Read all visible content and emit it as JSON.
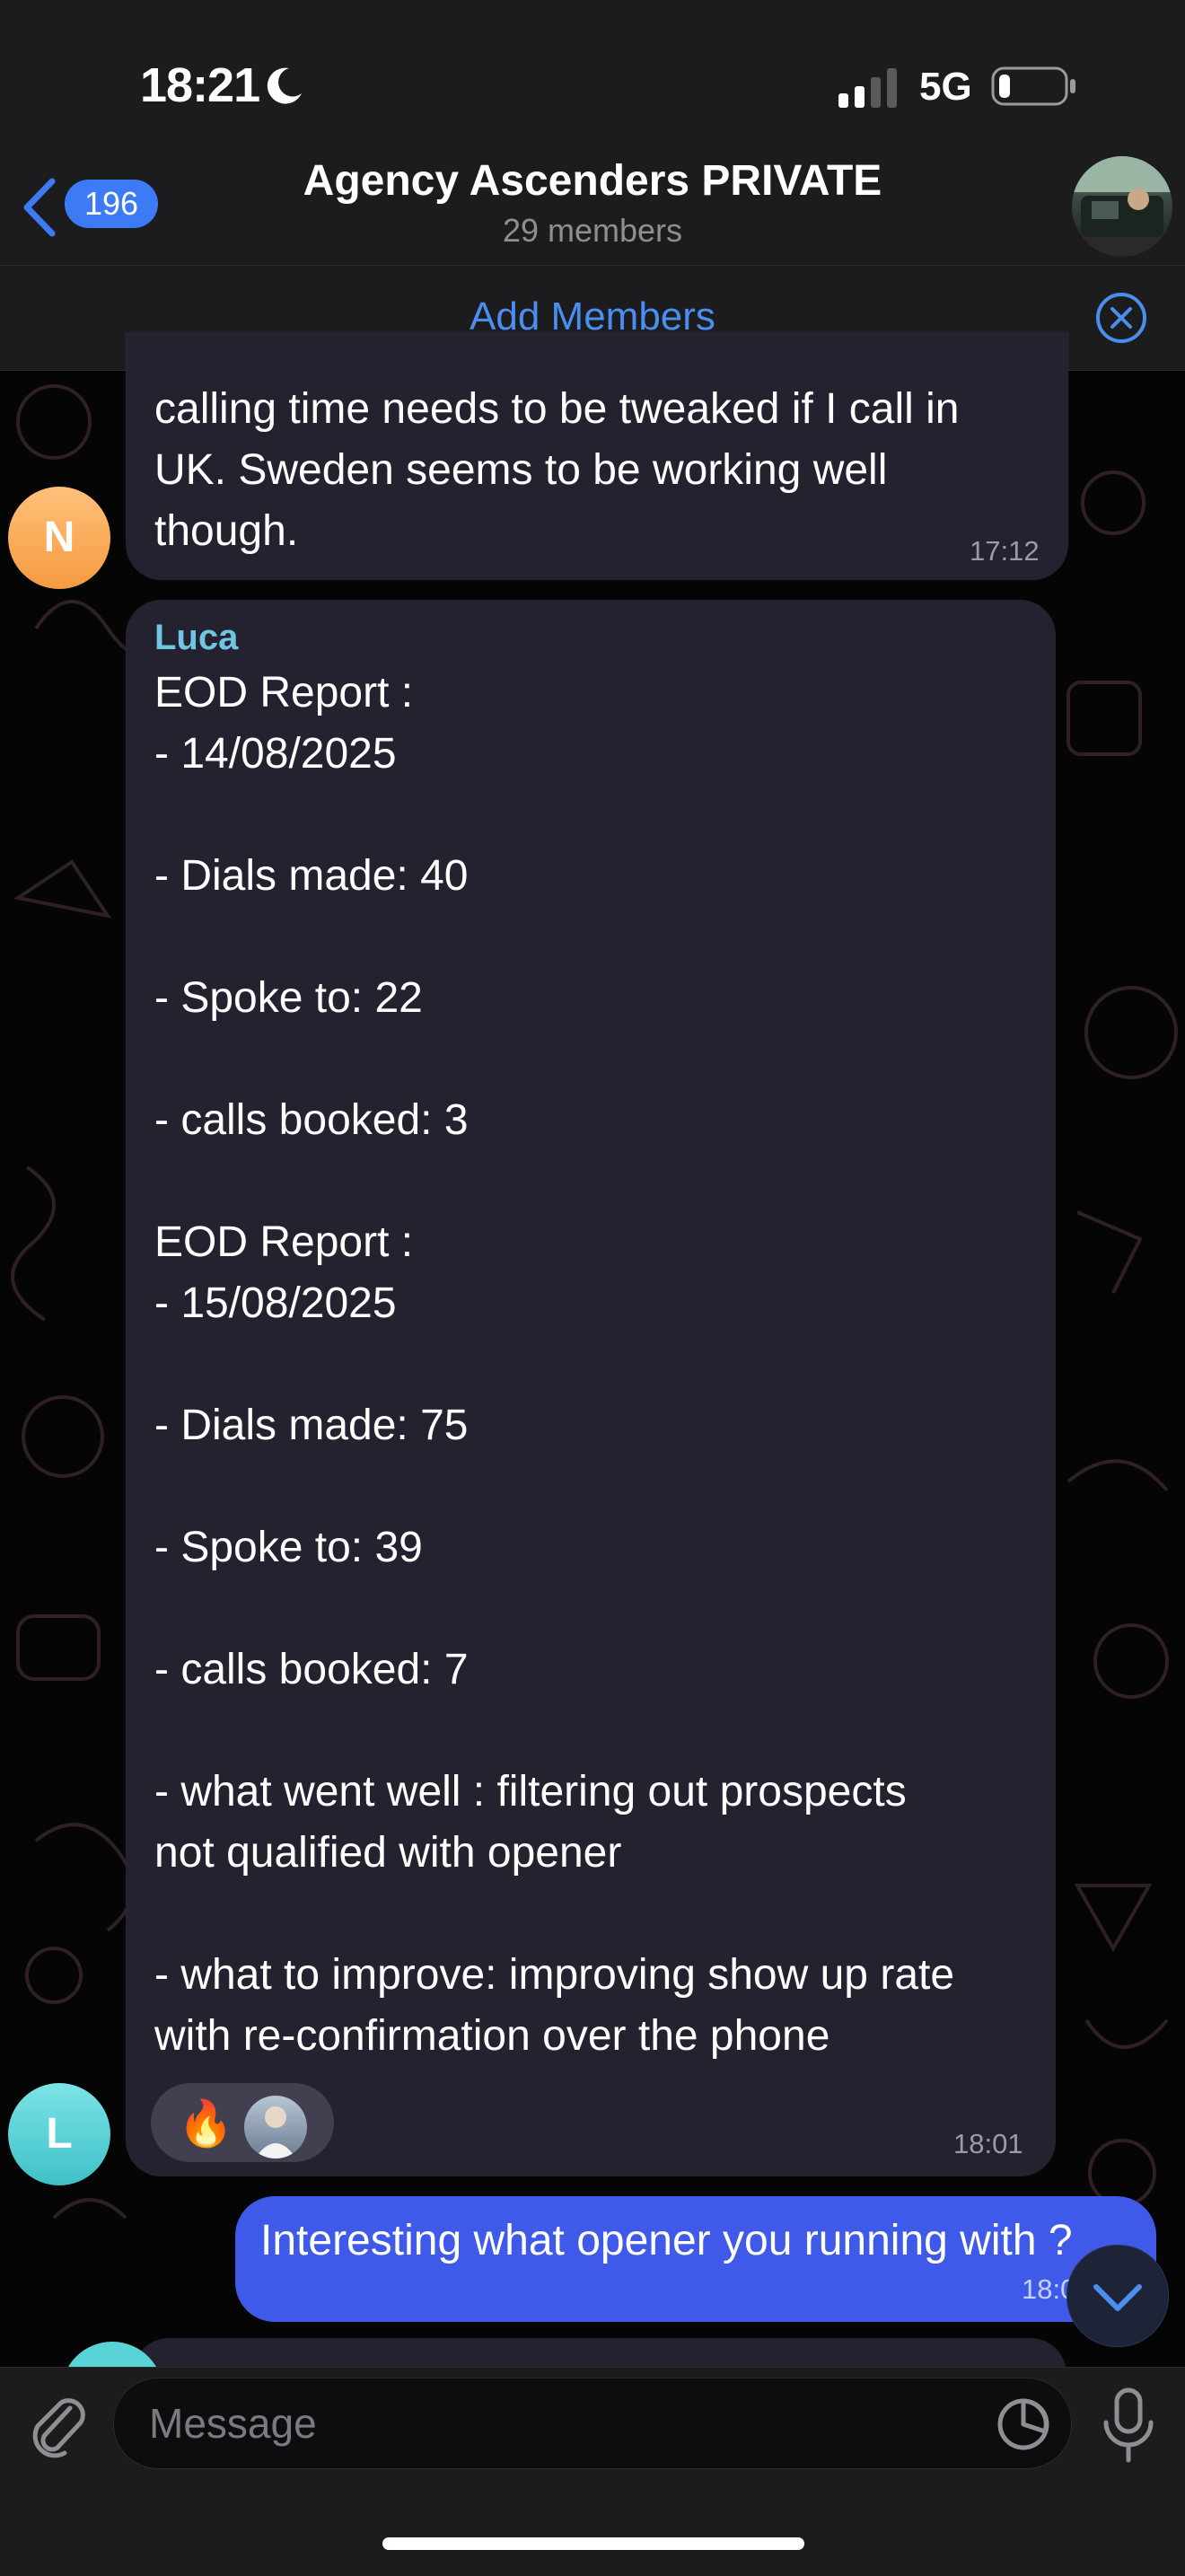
{
  "status_bar": {
    "time": "18:21",
    "network": "5G"
  },
  "header": {
    "back_count": "196",
    "title": "Agency Ascenders PRIVATE",
    "subtitle": "29 members"
  },
  "banner": {
    "add_members": "Add Members"
  },
  "messages": [
    {
      "avatar_letter": "N",
      "text": "calling time needs to be tweaked if I call in\nUK. Sweden seems to be working well\nthough.",
      "time": "17:12"
    },
    {
      "sender": "Luca",
      "avatar_letter": "L",
      "text": "EOD Report :\n- 14/08/2025\n\n- Dials made: 40\n\n- Spoke to: 22\n\n- calls booked: 3\n\nEOD Report :\n- 15/08/2025\n\n- Dials made: 75\n\n- Spoke to: 39\n\n- calls booked: 7\n\n- what went well : filtering out prospects\nnot qualified with opener\n\n- what to improve: improving show up rate\nwith re-confirmation over the phone",
      "time": "18:01",
      "reaction_emoji": "🔥"
    },
    {
      "outgoing": true,
      "text": "Interesting what opener you running with ?",
      "time": "18:0"
    }
  ],
  "composer": {
    "placeholder": "Message"
  },
  "colors": {
    "accent": "#3d7af5",
    "outgoing_bubble": "#3f5ae8",
    "sender_name": "#6fc5e4"
  }
}
